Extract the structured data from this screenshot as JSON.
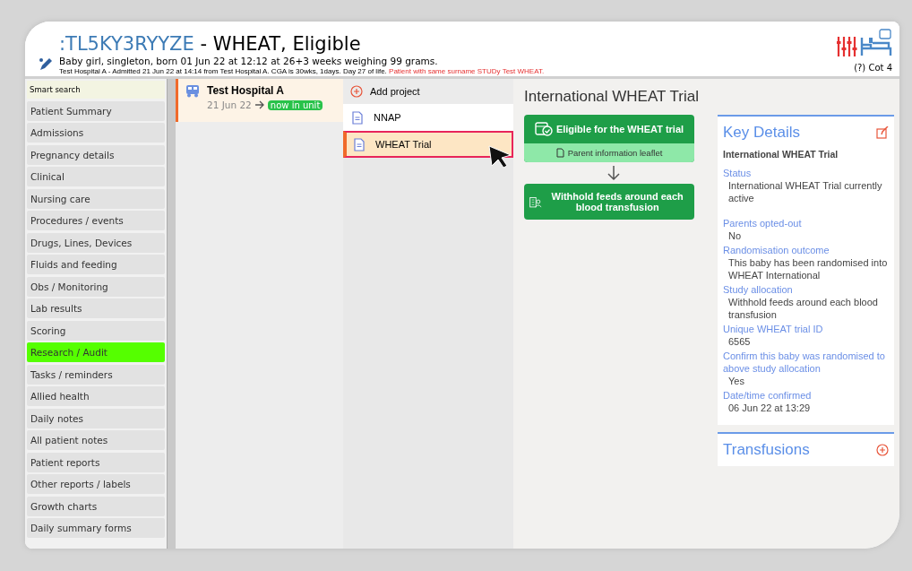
{
  "header": {
    "title_id": ":TL5KY3RYYZE",
    "title_name": " - WHEAT, Eligible",
    "birth_line": "Baby girl, singleton, born 01 Jun 22 at 12:12 at 26+3 weeks weighing 99 grams.",
    "admission_line": "Test Hospital A - Admitted 21 Jun 22 at 14:14 from Test Hospital A. CGA is 30wks, 1days. Day 27 of life.",
    "warning": "Patient with same surname STUDy Test WHEAT.",
    "cot": "(?) Cot 4"
  },
  "sidebar": {
    "search_label": "Smart search",
    "items": [
      {
        "label": "Patient Summary",
        "selected": false
      },
      {
        "label": "Admissions",
        "selected": false
      },
      {
        "label": "Pregnancy details",
        "selected": false
      },
      {
        "label": "Clinical",
        "selected": false
      },
      {
        "label": "Nursing care",
        "selected": false
      },
      {
        "label": "Procedures / events",
        "selected": false
      },
      {
        "label": "Drugs, Lines, Devices",
        "selected": false
      },
      {
        "label": "Fluids and feeding",
        "selected": false
      },
      {
        "label": "Obs / Monitoring",
        "selected": false
      },
      {
        "label": "Lab results",
        "selected": false
      },
      {
        "label": "Scoring",
        "selected": false
      },
      {
        "label": "Research / Audit",
        "selected": true
      },
      {
        "label": "Tasks / reminders",
        "selected": false
      },
      {
        "label": "Allied health",
        "selected": false
      },
      {
        "label": "Daily notes",
        "selected": false
      },
      {
        "label": "All patient notes",
        "selected": false
      },
      {
        "label": "Patient reports",
        "selected": false
      },
      {
        "label": "Other reports / labels",
        "selected": false
      },
      {
        "label": "Growth charts",
        "selected": false
      },
      {
        "label": "Daily summary forms",
        "selected": false
      }
    ]
  },
  "admissions": [
    {
      "hospital": "Test Hospital A",
      "date": "21 Jun 22",
      "status": "now in unit",
      "selected": true
    }
  ],
  "projects": {
    "add_label": "Add project",
    "items": [
      {
        "label": "NNAP",
        "selected": false
      },
      {
        "label": "WHEAT Trial",
        "selected": true
      }
    ]
  },
  "trial": {
    "title": "International WHEAT Trial",
    "steps": [
      {
        "kind": "check",
        "label": "Eligible for the WHEAT trial",
        "link": "Parent information leaflet"
      },
      {
        "kind": "feeds",
        "label": "Withhold feeds around each blood transfusion"
      }
    ]
  },
  "key_details": {
    "title": "Key Details",
    "subtitle": "International WHEAT Trial",
    "fields": [
      {
        "label": "Status",
        "value": " International WHEAT Trial currently active"
      },
      {
        "label": "Parents opted-out",
        "value": "No"
      },
      {
        "label": "Randomisation outcome",
        "value": "This baby has been randomised into WHEAT International"
      },
      {
        "label": "Study allocation",
        "value": "Withhold feeds around each blood transfusion"
      },
      {
        "label": "Unique WHEAT trial ID",
        "value": "6565"
      },
      {
        "label": "Confirm this baby was randomised to above study allocation",
        "value": "Yes"
      },
      {
        "label": "Date/time confirmed",
        "value": "06 Jun 22 at 13:29"
      }
    ]
  },
  "transfusions": {
    "title": "Transfusions"
  }
}
